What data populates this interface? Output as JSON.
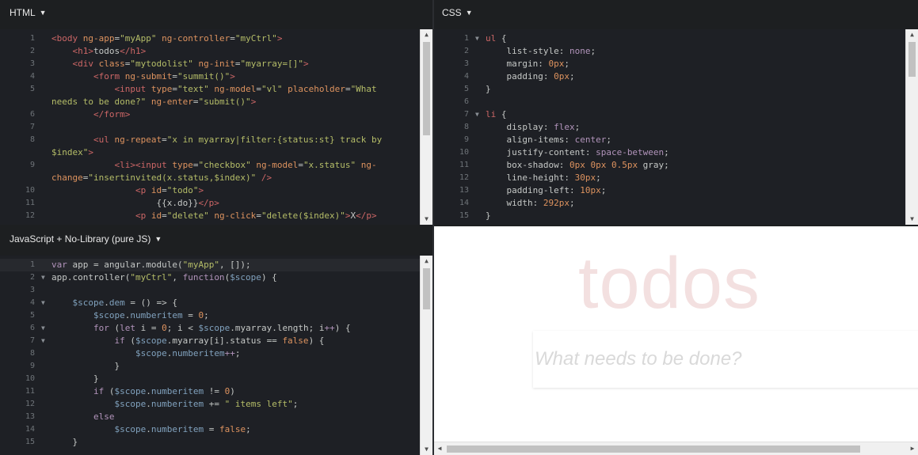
{
  "html_panel": {
    "title": "HTML",
    "lines": [
      {
        "n": "1",
        "spans": [
          [
            "t",
            "<body "
          ],
          [
            "a",
            "ng-app"
          ],
          [
            "p",
            "="
          ],
          [
            "s",
            "\"myApp\""
          ],
          [
            "p",
            " "
          ],
          [
            "a",
            "ng-controller"
          ],
          [
            "p",
            "="
          ],
          [
            "s",
            "\"myCtrl\""
          ],
          [
            "t",
            ">"
          ]
        ]
      },
      {
        "n": "2",
        "spans": [
          [
            "p",
            "    "
          ],
          [
            "t",
            "<h1>"
          ],
          [
            "p",
            "todos"
          ],
          [
            "t",
            "</h1>"
          ]
        ]
      },
      {
        "n": "3",
        "spans": [
          [
            "p",
            "    "
          ],
          [
            "t",
            "<div "
          ],
          [
            "a",
            "class"
          ],
          [
            "p",
            "="
          ],
          [
            "s",
            "\"mytodolist\""
          ],
          [
            "p",
            " "
          ],
          [
            "a",
            "ng-init"
          ],
          [
            "p",
            "="
          ],
          [
            "s",
            "\"myarray=[]\""
          ],
          [
            "t",
            ">"
          ]
        ]
      },
      {
        "n": "4",
        "spans": [
          [
            "p",
            "        "
          ],
          [
            "t",
            "<form "
          ],
          [
            "a",
            "ng-submit"
          ],
          [
            "p",
            "="
          ],
          [
            "s",
            "\"summit()\""
          ],
          [
            "t",
            ">"
          ]
        ]
      },
      {
        "n": "5",
        "spans": [
          [
            "p",
            "            "
          ],
          [
            "t",
            "<input "
          ],
          [
            "a",
            "type"
          ],
          [
            "p",
            "="
          ],
          [
            "s",
            "\"text\""
          ],
          [
            "p",
            " "
          ],
          [
            "a",
            "ng-model"
          ],
          [
            "p",
            "="
          ],
          [
            "s",
            "\"vl\""
          ],
          [
            "p",
            " "
          ],
          [
            "a",
            "placeholder"
          ],
          [
            "p",
            "="
          ],
          [
            "s",
            "\"What"
          ]
        ]
      },
      {
        "n": "",
        "spans": [
          [
            "s",
            "needs to be done?\""
          ],
          [
            "p",
            " "
          ],
          [
            "a",
            "ng-enter"
          ],
          [
            "p",
            "="
          ],
          [
            "s",
            "\"submit()\""
          ],
          [
            "t",
            ">"
          ]
        ]
      },
      {
        "n": "6",
        "spans": [
          [
            "p",
            "        "
          ],
          [
            "t",
            "</form>"
          ]
        ]
      },
      {
        "n": "7",
        "spans": []
      },
      {
        "n": "8",
        "spans": [
          [
            "p",
            "        "
          ],
          [
            "t",
            "<ul "
          ],
          [
            "a",
            "ng-repeat"
          ],
          [
            "p",
            "="
          ],
          [
            "s",
            "\"x in myarray|filter:{status:st} track by"
          ]
        ]
      },
      {
        "n": "",
        "spans": [
          [
            "s",
            "$index\""
          ],
          [
            "t",
            ">"
          ]
        ]
      },
      {
        "n": "9",
        "spans": [
          [
            "p",
            "            "
          ],
          [
            "t",
            "<li><input "
          ],
          [
            "a",
            "type"
          ],
          [
            "p",
            "="
          ],
          [
            "s",
            "\"checkbox\""
          ],
          [
            "p",
            " "
          ],
          [
            "a",
            "ng-model"
          ],
          [
            "p",
            "="
          ],
          [
            "s",
            "\"x.status\""
          ],
          [
            "p",
            " "
          ],
          [
            "a",
            "ng-"
          ]
        ]
      },
      {
        "n": "",
        "spans": [
          [
            "a",
            "change"
          ],
          [
            "p",
            "="
          ],
          [
            "s",
            "\"insertinvited(x.status,$index)\""
          ],
          [
            "p",
            " "
          ],
          [
            "t",
            "/>"
          ]
        ]
      },
      {
        "n": "10",
        "spans": [
          [
            "p",
            "                "
          ],
          [
            "t",
            "<p "
          ],
          [
            "a",
            "id"
          ],
          [
            "p",
            "="
          ],
          [
            "s",
            "\"todo\""
          ],
          [
            "t",
            ">"
          ]
        ]
      },
      {
        "n": "11",
        "spans": [
          [
            "p",
            "                    {{x.do}}"
          ],
          [
            "t",
            "</p>"
          ]
        ]
      },
      {
        "n": "12",
        "spans": [
          [
            "p",
            "                "
          ],
          [
            "t",
            "<p "
          ],
          [
            "a",
            "id"
          ],
          [
            "p",
            "="
          ],
          [
            "s",
            "\"delete\""
          ],
          [
            "p",
            " "
          ],
          [
            "a",
            "ng-click"
          ],
          [
            "p",
            "="
          ],
          [
            "s",
            "\"delete($index)\""
          ],
          [
            "t",
            ">"
          ],
          [
            "p",
            "X"
          ],
          [
            "t",
            "</p>"
          ]
        ]
      }
    ]
  },
  "css_panel": {
    "title": "CSS",
    "lines": [
      {
        "n": "1",
        "fold": true,
        "spans": [
          [
            "t",
            "ul"
          ],
          [
            "p",
            " {"
          ]
        ]
      },
      {
        "n": "2",
        "spans": [
          [
            "p",
            "    list-style: "
          ],
          [
            "k",
            "none"
          ],
          [
            "p",
            ";"
          ]
        ]
      },
      {
        "n": "3",
        "spans": [
          [
            "p",
            "    margin: "
          ],
          [
            "n",
            "0px"
          ],
          [
            "p",
            ";"
          ]
        ]
      },
      {
        "n": "4",
        "spans": [
          [
            "p",
            "    padding: "
          ],
          [
            "n",
            "0px"
          ],
          [
            "p",
            ";"
          ]
        ]
      },
      {
        "n": "5",
        "spans": [
          [
            "p",
            "}"
          ]
        ]
      },
      {
        "n": "6",
        "spans": []
      },
      {
        "n": "7",
        "fold": true,
        "spans": [
          [
            "t",
            "li"
          ],
          [
            "p",
            " {"
          ]
        ]
      },
      {
        "n": "8",
        "spans": [
          [
            "p",
            "    display: "
          ],
          [
            "k",
            "flex"
          ],
          [
            "p",
            ";"
          ]
        ]
      },
      {
        "n": "9",
        "spans": [
          [
            "p",
            "    align-items: "
          ],
          [
            "k",
            "center"
          ],
          [
            "p",
            ";"
          ]
        ]
      },
      {
        "n": "10",
        "spans": [
          [
            "p",
            "    justify-content: "
          ],
          [
            "k",
            "space-between"
          ],
          [
            "p",
            ";"
          ]
        ]
      },
      {
        "n": "11",
        "spans": [
          [
            "p",
            "    box-shadow: "
          ],
          [
            "n",
            "0px 0px 0.5px"
          ],
          [
            "p",
            " gray;"
          ]
        ]
      },
      {
        "n": "12",
        "spans": [
          [
            "p",
            "    line-height: "
          ],
          [
            "n",
            "30px"
          ],
          [
            "p",
            ";"
          ]
        ]
      },
      {
        "n": "13",
        "spans": [
          [
            "p",
            "    padding-left: "
          ],
          [
            "n",
            "10px"
          ],
          [
            "p",
            ";"
          ]
        ]
      },
      {
        "n": "14",
        "spans": [
          [
            "p",
            "    width: "
          ],
          [
            "n",
            "292px"
          ],
          [
            "p",
            ";"
          ]
        ]
      },
      {
        "n": "15",
        "spans": [
          [
            "p",
            "}"
          ]
        ]
      }
    ]
  },
  "js_panel": {
    "title": "JavaScript + No-Library (pure JS)",
    "lines": [
      {
        "n": "1",
        "cur": true,
        "spans": [
          [
            "k",
            "var"
          ],
          [
            "p",
            " app = angular.module("
          ],
          [
            "s",
            "\"myApp\""
          ],
          [
            "p",
            ", []);"
          ]
        ]
      },
      {
        "n": "2",
        "fold": true,
        "spans": [
          [
            "p",
            "app.controller("
          ],
          [
            "s",
            "\"myCtrl\""
          ],
          [
            "p",
            ", "
          ],
          [
            "k",
            "function"
          ],
          [
            "p",
            "("
          ],
          [
            "v",
            "$scope"
          ],
          [
            "p",
            ") {"
          ]
        ]
      },
      {
        "n": "3",
        "spans": []
      },
      {
        "n": "4",
        "fold": true,
        "spans": [
          [
            "p",
            "    "
          ],
          [
            "v",
            "$scope"
          ],
          [
            "p",
            "."
          ],
          [
            "v",
            "dem"
          ],
          [
            "p",
            " = () => {"
          ]
        ]
      },
      {
        "n": "5",
        "spans": [
          [
            "p",
            "        "
          ],
          [
            "v",
            "$scope"
          ],
          [
            "p",
            "."
          ],
          [
            "v",
            "numberitem"
          ],
          [
            "p",
            " = "
          ],
          [
            "n",
            "0"
          ],
          [
            "p",
            ";"
          ]
        ]
      },
      {
        "n": "6",
        "fold": true,
        "spans": [
          [
            "p",
            "        "
          ],
          [
            "k",
            "for"
          ],
          [
            "p",
            " ("
          ],
          [
            "k",
            "let"
          ],
          [
            "p",
            " i = "
          ],
          [
            "n",
            "0"
          ],
          [
            "p",
            "; i < "
          ],
          [
            "v",
            "$scope"
          ],
          [
            "p",
            ".myarray.length; i"
          ],
          [
            "k",
            "++"
          ],
          [
            "p",
            ") {"
          ]
        ]
      },
      {
        "n": "7",
        "fold": true,
        "spans": [
          [
            "p",
            "            "
          ],
          [
            "k",
            "if"
          ],
          [
            "p",
            " ("
          ],
          [
            "v",
            "$scope"
          ],
          [
            "p",
            ".myarray[i].status == "
          ],
          [
            "n",
            "false"
          ],
          [
            "p",
            ") {"
          ]
        ]
      },
      {
        "n": "8",
        "spans": [
          [
            "p",
            "                "
          ],
          [
            "v",
            "$scope"
          ],
          [
            "p",
            "."
          ],
          [
            "v",
            "numberitem"
          ],
          [
            "k",
            "++"
          ],
          [
            "p",
            ";"
          ]
        ]
      },
      {
        "n": "9",
        "spans": [
          [
            "p",
            "            }"
          ]
        ]
      },
      {
        "n": "10",
        "spans": [
          [
            "p",
            "        }"
          ]
        ]
      },
      {
        "n": "11",
        "spans": [
          [
            "p",
            "        "
          ],
          [
            "k",
            "if"
          ],
          [
            "p",
            " ("
          ],
          [
            "v",
            "$scope"
          ],
          [
            "p",
            "."
          ],
          [
            "v",
            "numberitem"
          ],
          [
            "p",
            " != "
          ],
          [
            "n",
            "0"
          ],
          [
            "p",
            ")"
          ]
        ]
      },
      {
        "n": "12",
        "spans": [
          [
            "p",
            "            "
          ],
          [
            "v",
            "$scope"
          ],
          [
            "p",
            "."
          ],
          [
            "v",
            "numberitem"
          ],
          [
            "p",
            " += "
          ],
          [
            "s",
            "\" items left\""
          ],
          [
            "p",
            ";"
          ]
        ]
      },
      {
        "n": "13",
        "spans": [
          [
            "k",
            "        else"
          ]
        ]
      },
      {
        "n": "14",
        "spans": [
          [
            "p",
            "            "
          ],
          [
            "v",
            "$scope"
          ],
          [
            "p",
            "."
          ],
          [
            "v",
            "numberitem"
          ],
          [
            "p",
            " = "
          ],
          [
            "n",
            "false"
          ],
          [
            "p",
            ";"
          ]
        ]
      },
      {
        "n": "15",
        "spans": [
          [
            "p",
            "    }"
          ]
        ]
      }
    ]
  },
  "result": {
    "heading": "todos",
    "input_placeholder": "What needs to be done?"
  }
}
